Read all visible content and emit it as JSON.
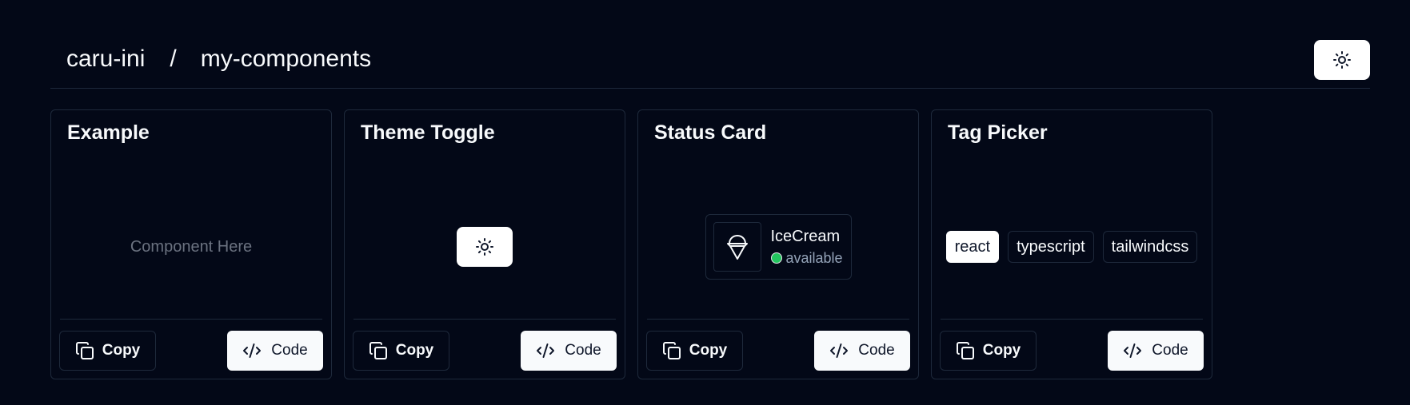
{
  "header": {
    "owner": "caru-ini",
    "separator": "/",
    "repo": "my-components",
    "theme_toggle_icon": "sun-icon"
  },
  "cards": [
    {
      "title": "Example",
      "placeholder": "Component Here",
      "copy_label": "Copy",
      "code_label": "Code"
    },
    {
      "title": "Theme Toggle",
      "toggle_icon": "sun-icon",
      "copy_label": "Copy",
      "code_label": "Code"
    },
    {
      "title": "Status Card",
      "status": {
        "icon": "ice-cream-icon",
        "name": "IceCream",
        "state": "available",
        "state_color": "#22c55e"
      },
      "copy_label": "Copy",
      "code_label": "Code"
    },
    {
      "title": "Tag Picker",
      "tags": [
        {
          "label": "react",
          "selected": true
        },
        {
          "label": "typescript",
          "selected": false
        },
        {
          "label": "tailwindcss",
          "selected": false
        }
      ],
      "copy_label": "Copy",
      "code_label": "Code"
    }
  ],
  "colors": {
    "background": "#030817",
    "border": "#1e293b",
    "foreground": "#f8fafc",
    "primary_button": "#f8fafc",
    "muted_text": "#6b7280"
  }
}
